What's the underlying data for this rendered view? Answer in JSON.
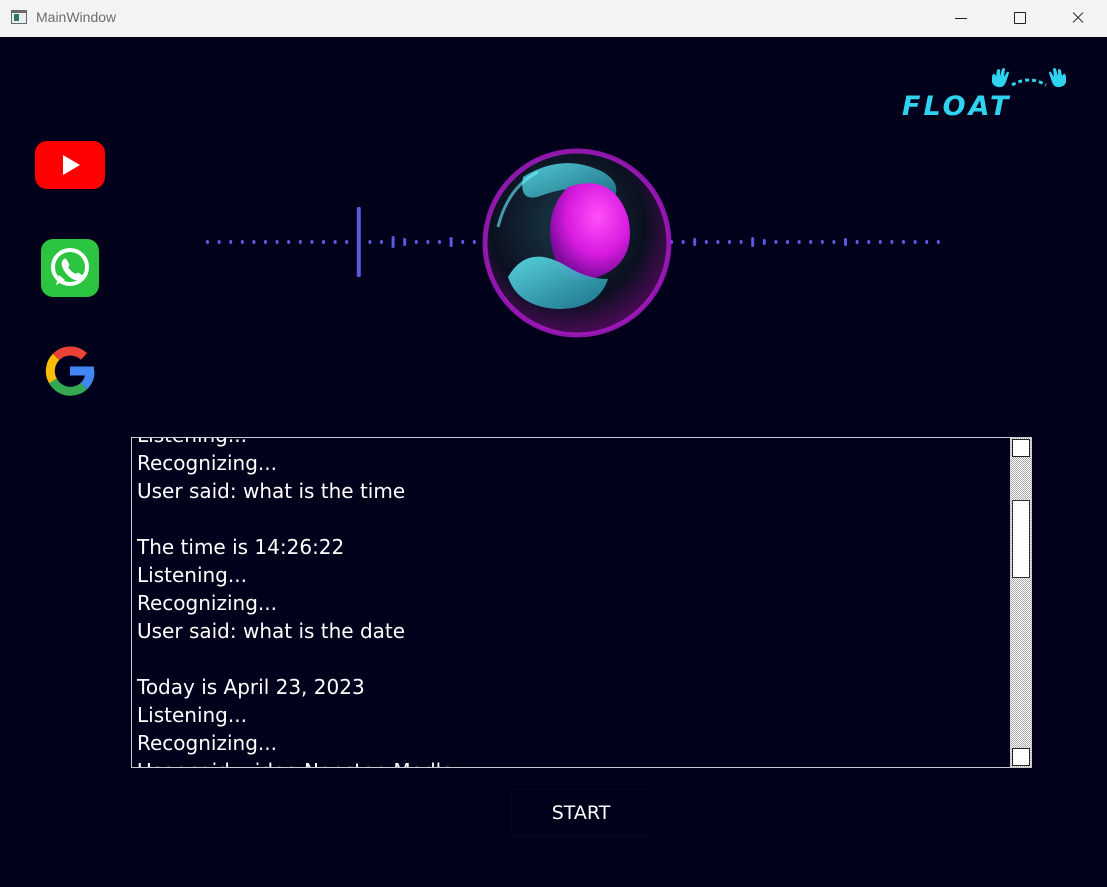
{
  "window": {
    "title": "MainWindow",
    "controls": [
      "minimize",
      "maximize",
      "close"
    ]
  },
  "logo": {
    "text": "FLOAT",
    "color": "#2fd3f0"
  },
  "sidebar": {
    "items": [
      {
        "name": "YouTube",
        "icon": "youtube-icon"
      },
      {
        "name": "WhatsApp",
        "icon": "whatsapp-icon"
      },
      {
        "name": "Google",
        "icon": "google-icon"
      }
    ]
  },
  "visualizer": {
    "icon": "voice-orb-icon",
    "wave_color": "#5b5be0",
    "orb_colors": [
      "#e11fe6",
      "#2bb7c9"
    ]
  },
  "log": {
    "lines": [
      "Listening...",
      "Recognizing...",
      "User said: what is the time",
      "",
      "The time is 14:26:22",
      "Listening...",
      "Recognizing...",
      "User said: what is the date",
      "",
      "Today is April 23, 2023",
      "Listening...",
      "Recognizing...",
      "User said: video Nonstop Medley"
    ]
  },
  "start_button": {
    "label": "START"
  },
  "colors": {
    "background": "#02011b",
    "text": "#ffffff"
  }
}
